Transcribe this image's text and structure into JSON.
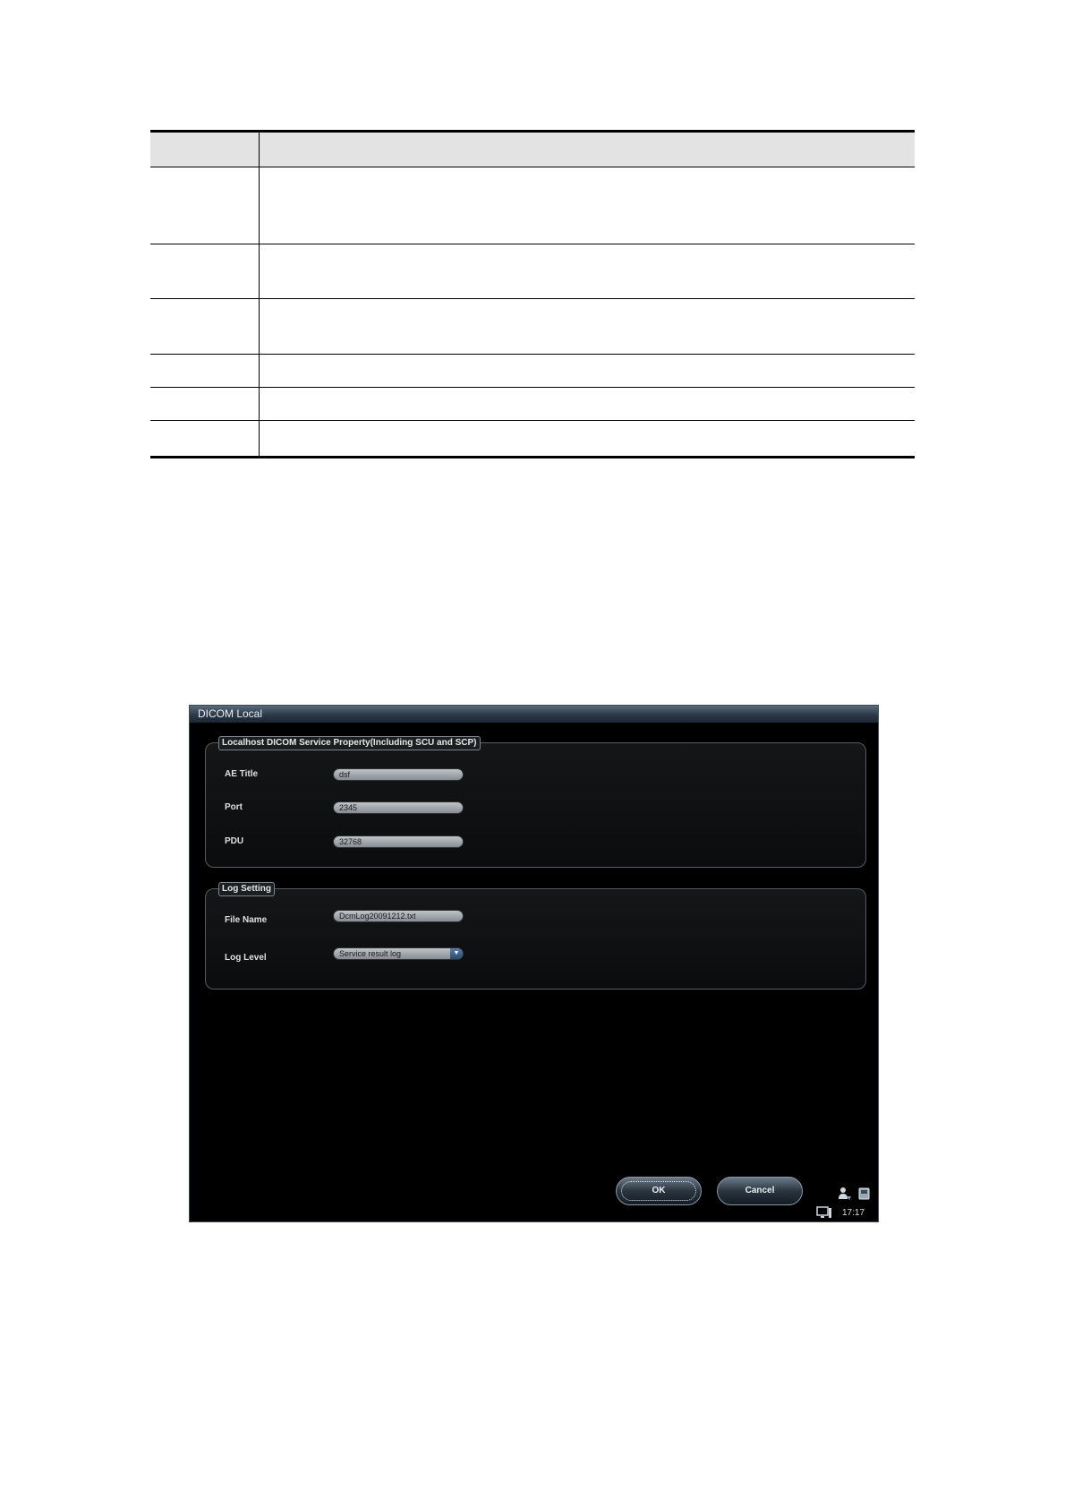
{
  "dialog": {
    "title": "DICOM Local",
    "service_group": {
      "title": "Localhost DICOM Service Property(Including SCU and SCP)",
      "ae_title": {
        "label": "AE Title",
        "value": "dsf"
      },
      "port": {
        "label": "Port",
        "value": "2345"
      },
      "pdu": {
        "label": "PDU",
        "value": "32768"
      }
    },
    "log_group": {
      "title": "Log Setting",
      "file_name": {
        "label": "File Name",
        "value": "DcmLog20091212.txt"
      },
      "log_level": {
        "label": "Log Level",
        "value": "Service result log"
      }
    },
    "ok_label": "OK",
    "cancel_label": "Cancel",
    "status": {
      "time": "17:17"
    }
  },
  "colors": {
    "dialog_background": "#000000",
    "titlebar": "#2c3947",
    "field": "#a9aeb3",
    "accent": "#3a5c86"
  }
}
